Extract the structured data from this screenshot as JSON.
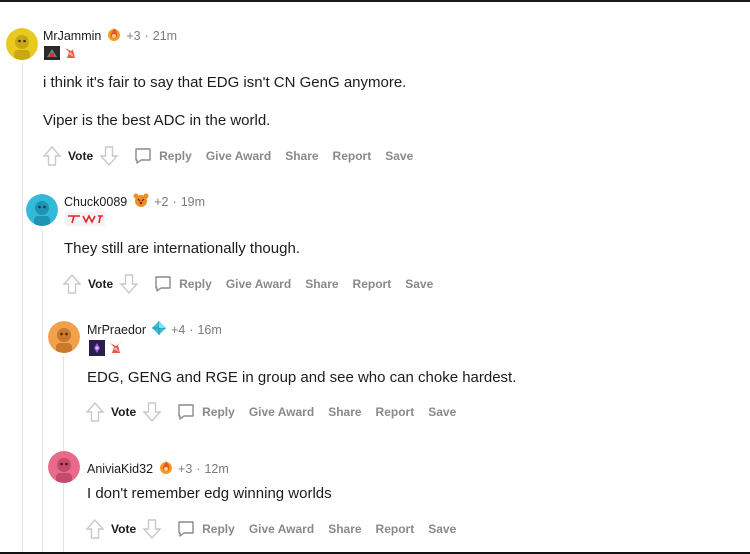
{
  "comments": [
    {
      "username": "MrJammin",
      "karma": "+3",
      "separator": "·",
      "time": "21m",
      "award_icon": "fire-award-icon",
      "flair_icons": [
        "team-flair-icon",
        "rank-flair-icon"
      ],
      "paragraphs": [
        "i think it's fair to say that EDG isn't CN GenG anymore.",
        "Viper is the best ADC in the world."
      ],
      "avatar_color": "#e8c91f"
    },
    {
      "username": "Chuck0089",
      "karma": "+2",
      "separator": "·",
      "time": "19m",
      "award_icon": "tiger-award-icon",
      "flair_icons": [
        "t1-flair-icon"
      ],
      "paragraphs": [
        "They still are internationally though."
      ],
      "avatar_color": "#35b9d9"
    },
    {
      "username": "MrPraedor",
      "karma": "+4",
      "separator": "·",
      "time": "16m",
      "award_icon": "crystal-award-icon",
      "flair_icons": [
        "champion-flair-icon",
        "rank-flair-icon"
      ],
      "paragraphs": [
        "EDG, GENG and RGE in group and see who can choke hardest."
      ],
      "avatar_color": "#f2a04b"
    },
    {
      "username": "AniviaKid32",
      "karma": "+3",
      "separator": "·",
      "time": "12m",
      "award_icon": "fire-award-icon",
      "flair_icons": [],
      "paragraphs": [
        "I don't remember edg winning worlds"
      ],
      "avatar_color": "#e86b8a"
    }
  ],
  "actions": {
    "vote": "Vote",
    "reply": "Reply",
    "give_award": "Give Award",
    "share": "Share",
    "report": "Report",
    "save": "Save"
  },
  "colors": {
    "text": "#1c1c1c",
    "meta": "#7c7c7c",
    "action": "#878a8c",
    "thread": "#e3e3e3"
  }
}
